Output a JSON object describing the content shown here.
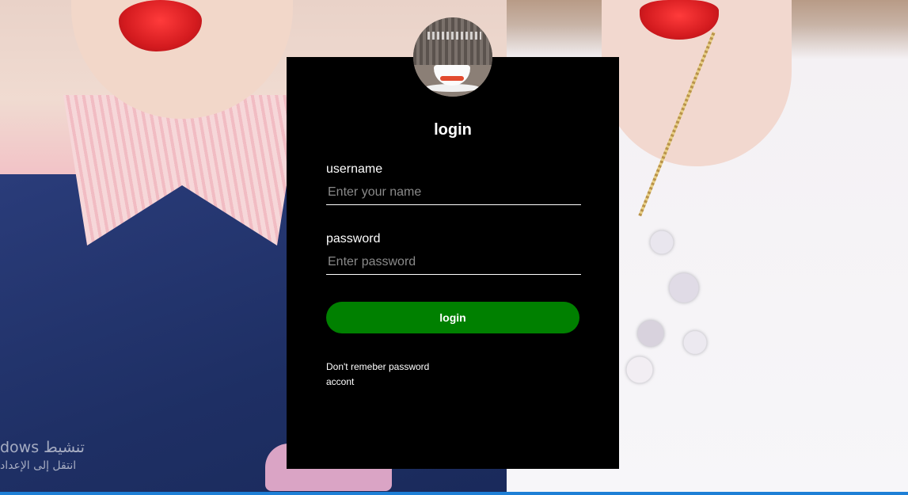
{
  "login_form": {
    "title": "login",
    "username": {
      "label": "username",
      "placeholder": "Enter your name",
      "value": ""
    },
    "password": {
      "label": "password",
      "placeholder": "Enter password",
      "value": ""
    },
    "submit_label": "login",
    "forgot_password_link": "Don't remeber password",
    "account_link": "accont"
  },
  "watermark": {
    "line1": "dows تنشيط",
    "line2": "انتقل إلى الإعداد"
  },
  "colors": {
    "panel_background": "#000000",
    "button_background": "#008000",
    "text": "#ffffff",
    "placeholder": "#8a8a8a"
  }
}
